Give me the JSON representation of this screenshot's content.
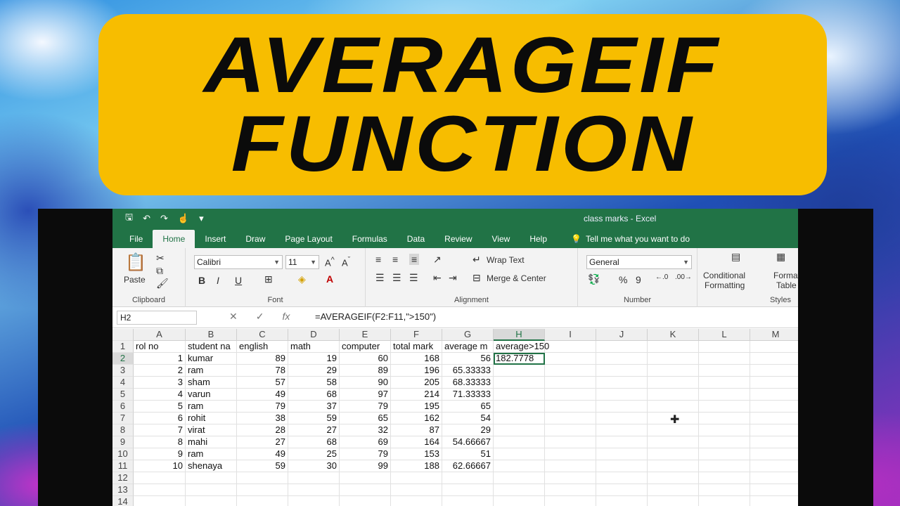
{
  "banner": {
    "line1": "AVERAGEIF",
    "line2": "FUNCTION"
  },
  "window": {
    "doc_title": "class marks  -  Excel"
  },
  "tabs": [
    "File",
    "Home",
    "Insert",
    "Draw",
    "Page Layout",
    "Formulas",
    "Data",
    "Review",
    "View",
    "Help"
  ],
  "active_tab": "Home",
  "tell_me": "Tell me what you want to do",
  "ribbon": {
    "clipboard": {
      "paste": "Paste",
      "label": "Clipboard"
    },
    "font": {
      "name": "Calibri",
      "size": "11",
      "label": "Font",
      "bold": "B",
      "italic": "I",
      "underline": "U"
    },
    "alignment": {
      "wrap": "Wrap Text",
      "merge": "Merge & Center",
      "label": "Alignment"
    },
    "number": {
      "format": "General",
      "percent": "%",
      "comma": "9",
      "label": "Number"
    },
    "styles": {
      "conditional": [
        "Conditional",
        "Formatting"
      ],
      "format_table": [
        "Format",
        "Table"
      ],
      "label": "Styles"
    }
  },
  "formula_bar": {
    "cell_ref": "H2",
    "formula": "=AVERAGEIF(F2:F11,\">150\")"
  },
  "columns": [
    "A",
    "B",
    "C",
    "D",
    "E",
    "F",
    "G",
    "H",
    "I",
    "J",
    "K",
    "L",
    "M"
  ],
  "rows": [
    [
      "rol no",
      "student na",
      "english",
      "math",
      "computer",
      "total mark",
      "average m",
      "average>150",
      "",
      "",
      "",
      "",
      ""
    ],
    [
      "1",
      "kumar",
      "89",
      "19",
      "60",
      "168",
      "56",
      "182.7778",
      "",
      "",
      "",
      "",
      ""
    ],
    [
      "2",
      "ram",
      "78",
      "29",
      "89",
      "196",
      "65.33333",
      "",
      "",
      "",
      "",
      "",
      ""
    ],
    [
      "3",
      "sham",
      "57",
      "58",
      "90",
      "205",
      "68.33333",
      "",
      "",
      "",
      "",
      "",
      ""
    ],
    [
      "4",
      "varun",
      "49",
      "68",
      "97",
      "214",
      "71.33333",
      "",
      "",
      "",
      "",
      "",
      ""
    ],
    [
      "5",
      "ram",
      "79",
      "37",
      "79",
      "195",
      "65",
      "",
      "",
      "",
      "",
      "",
      ""
    ],
    [
      "6",
      "rohit",
      "38",
      "59",
      "65",
      "162",
      "54",
      "",
      "",
      "",
      "",
      "",
      ""
    ],
    [
      "7",
      "virat",
      "28",
      "27",
      "32",
      "87",
      "29",
      "",
      "",
      "",
      "",
      "",
      ""
    ],
    [
      "8",
      "mahi",
      "27",
      "68",
      "69",
      "164",
      "54.66667",
      "",
      "",
      "",
      "",
      "",
      ""
    ],
    [
      "9",
      "ram",
      "49",
      "25",
      "79",
      "153",
      "51",
      "",
      "",
      "",
      "",
      "",
      ""
    ],
    [
      "10",
      "shenaya",
      "59",
      "30",
      "99",
      "188",
      "62.66667",
      "",
      "",
      "",
      "",
      "",
      ""
    ],
    [
      "",
      "",
      "",
      "",
      "",
      "",
      "",
      "",
      "",
      "",
      "",
      "",
      ""
    ],
    [
      "",
      "",
      "",
      "",
      "",
      "",
      "",
      "",
      "",
      "",
      "",
      "",
      ""
    ],
    [
      "",
      "",
      "",
      "",
      "",
      "",
      "",
      "",
      "",
      "",
      "",
      "",
      ""
    ]
  ]
}
